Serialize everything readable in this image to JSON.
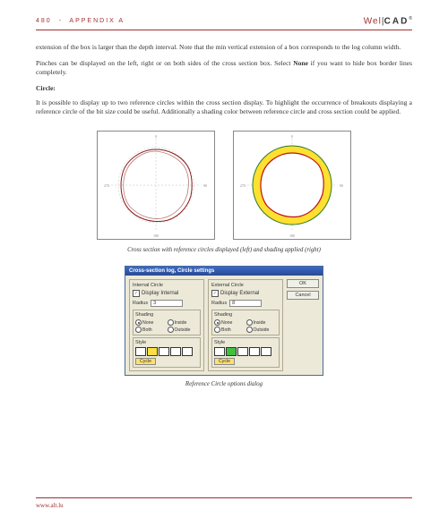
{
  "header": {
    "page_num": "480",
    "section": "APPENDIX A",
    "logo_left": "Wel",
    "logo_right": "CAD"
  },
  "paragraphs": {
    "p1": "extension of the box is larger than the depth interval. Note that the min vertical extension of a box corresponds to the log column width.",
    "p2a": "Pinches can be displayed on the left, right or on both sides of the cross section box. Select ",
    "p2b": "None",
    "p2c": " if you want to hide box border lines completely.",
    "circle_head": "Circle:",
    "p3": "It is possible to display up to two reference circles within the cross section display. To highlight the occurrence of breakouts displaying a reference circle of the bit size could be useful. Additionally a shading color between reference circle and cross section could be applied."
  },
  "captions": {
    "fig1": "Cross section with reference circles displayed (left) and shading applied (right)",
    "fig2": "Reference Circle options dialog"
  },
  "dialog": {
    "title": "Cross-section log, Circle settings",
    "internal": {
      "group": "Internal Circle",
      "display": "Display Internal",
      "display_checked": true,
      "radius_label": "Radius",
      "radius_value": "3",
      "shading_label": "Shading",
      "opt_none": "None",
      "opt_inside": "Inside",
      "opt_both": "Both",
      "opt_outside": "Outside",
      "style_label": "Style",
      "cycle": "Cycle",
      "swatches": [
        "#ffffff",
        "#ffe040",
        "#ffffff",
        "#ffffff",
        "#ffffff"
      ]
    },
    "external": {
      "group": "External Circle",
      "display": "Display External",
      "display_checked": true,
      "radius_label": "Radius",
      "radius_value": "8",
      "shading_label": "Shading",
      "opt_none": "None",
      "opt_inside": "Inside",
      "opt_both": "Both",
      "opt_outside": "Outside",
      "style_label": "Style",
      "cycle": "Cycle",
      "swatches": [
        "#ffffff",
        "#40c040",
        "#ffffff",
        "#ffffff",
        "#ffffff"
      ]
    },
    "buttons": {
      "ok": "OK",
      "cancel": "Cancel"
    }
  },
  "axis_labels": {
    "n0": "0",
    "n90": "90",
    "n180": "180",
    "n270": "270"
  },
  "footer": {
    "url": "www.alt.lu"
  }
}
